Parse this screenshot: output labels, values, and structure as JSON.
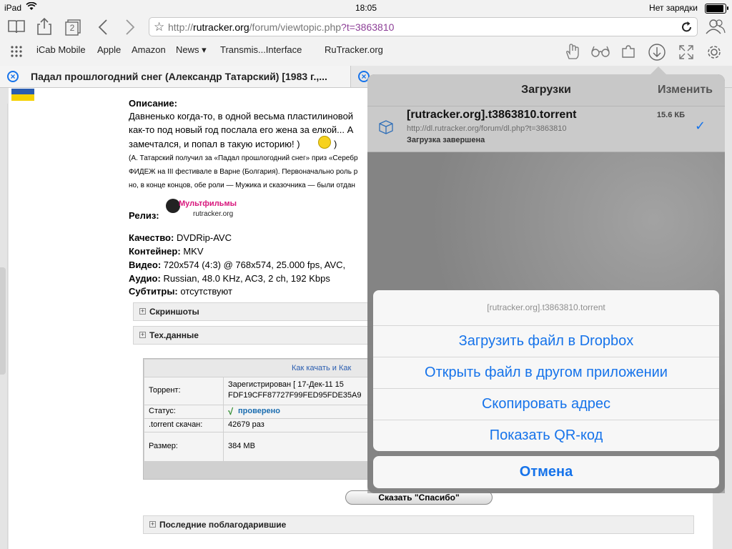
{
  "status_bar": {
    "device": "iPad",
    "time": "18:05",
    "battery_text": "Нет зарядки"
  },
  "toolbar": {
    "tabs_count": "2",
    "url_domain": "rutracker.org",
    "url_prefix": "http://",
    "url_path": "/forum/viewtopic.php",
    "url_query": "?t=3863810"
  },
  "bookmarks": [
    "iCab Mobile",
    "Apple",
    "Amazon",
    "News ▾",
    "Transmis...Interface",
    "RuTracker.org"
  ],
  "tabs": [
    {
      "title": "Падал прошлогодний снег (Александр Татарский) [1983 г.,..."
    }
  ],
  "page": {
    "description_label": "Описание",
    "desc_line1": "Давненько когда-то, в одной весьма пластилиновой",
    "desc_line2": "как-то под новый год послала его жена за елкой... А",
    "desc_line3": "замечтался, и попал в такую историю! )",
    "desc_close": ")",
    "note_line1": "(А. Татарский получил за «Падал прошлогодний снег» приз «Серебр",
    "note_line2": "ФИДЕЖ на III фестивале в Варне (Болгария). Первоначально роль р",
    "note_line3": "но, в конце концов, обе роли — Мужика и сказочника — были отдан",
    "release_label": "Релиз",
    "release_logo_title": "Мультфильмы",
    "release_logo_sub": "rutracker.org",
    "specs": [
      {
        "k": "Качество",
        "v": "DVDRip-AVC"
      },
      {
        "k": "Контейнер",
        "v": "MKV"
      },
      {
        "k": "Видео",
        "v": "720x574 (4:3) @ 768x574, 25.000 fps, AVC,"
      },
      {
        "k": "Аудио",
        "v": "Russian, 48.0 KHz, AC3, 2 ch, 192 Kbps"
      },
      {
        "k": "Субтитры",
        "v": "отсутствуют"
      }
    ],
    "spoiler_screens": "Скриншоты",
    "spoiler_tech": "Тех.данные",
    "table_header": "Как качать и Как",
    "table_rows": [
      {
        "k": "Торрент:",
        "v1": "Зарегистрирован  [ 17-Дек-11 15",
        "v2": "FDF19CFF87727F99FED95FDE35A9"
      },
      {
        "k": "Статус:",
        "v1": "проверено"
      },
      {
        "k": ".torrent скачан:",
        "v1": "42679 раз"
      },
      {
        "k": "Размер:",
        "v1": "384 MB"
      }
    ],
    "status_check": "√",
    "thanks_button": "Сказать \"Спасибо\"",
    "spoiler_thanked": "Последние поблагодарившие"
  },
  "downloads": {
    "title": "Загрузки",
    "edit": "Изменить",
    "item": {
      "name": "[rutracker.org].t3863810.torrent",
      "url": "http://dl.rutracker.org/forum/dl.php?t=3863810",
      "status": "Загрузка завершена",
      "size": "15.6 КБ",
      "check": "✓"
    }
  },
  "action_sheet": {
    "title": "[rutracker.org].t3863810.torrent",
    "buttons": [
      "Загрузить файл в Dropbox",
      "Открыть файл в другом приложении",
      "Скопировать адрес",
      "Показать QR-код"
    ],
    "cancel": "Отмена"
  },
  "colors": {
    "accent": "#1673ea",
    "flag_blue": "#2a5db0",
    "flag_yellow": "#f5d100"
  }
}
